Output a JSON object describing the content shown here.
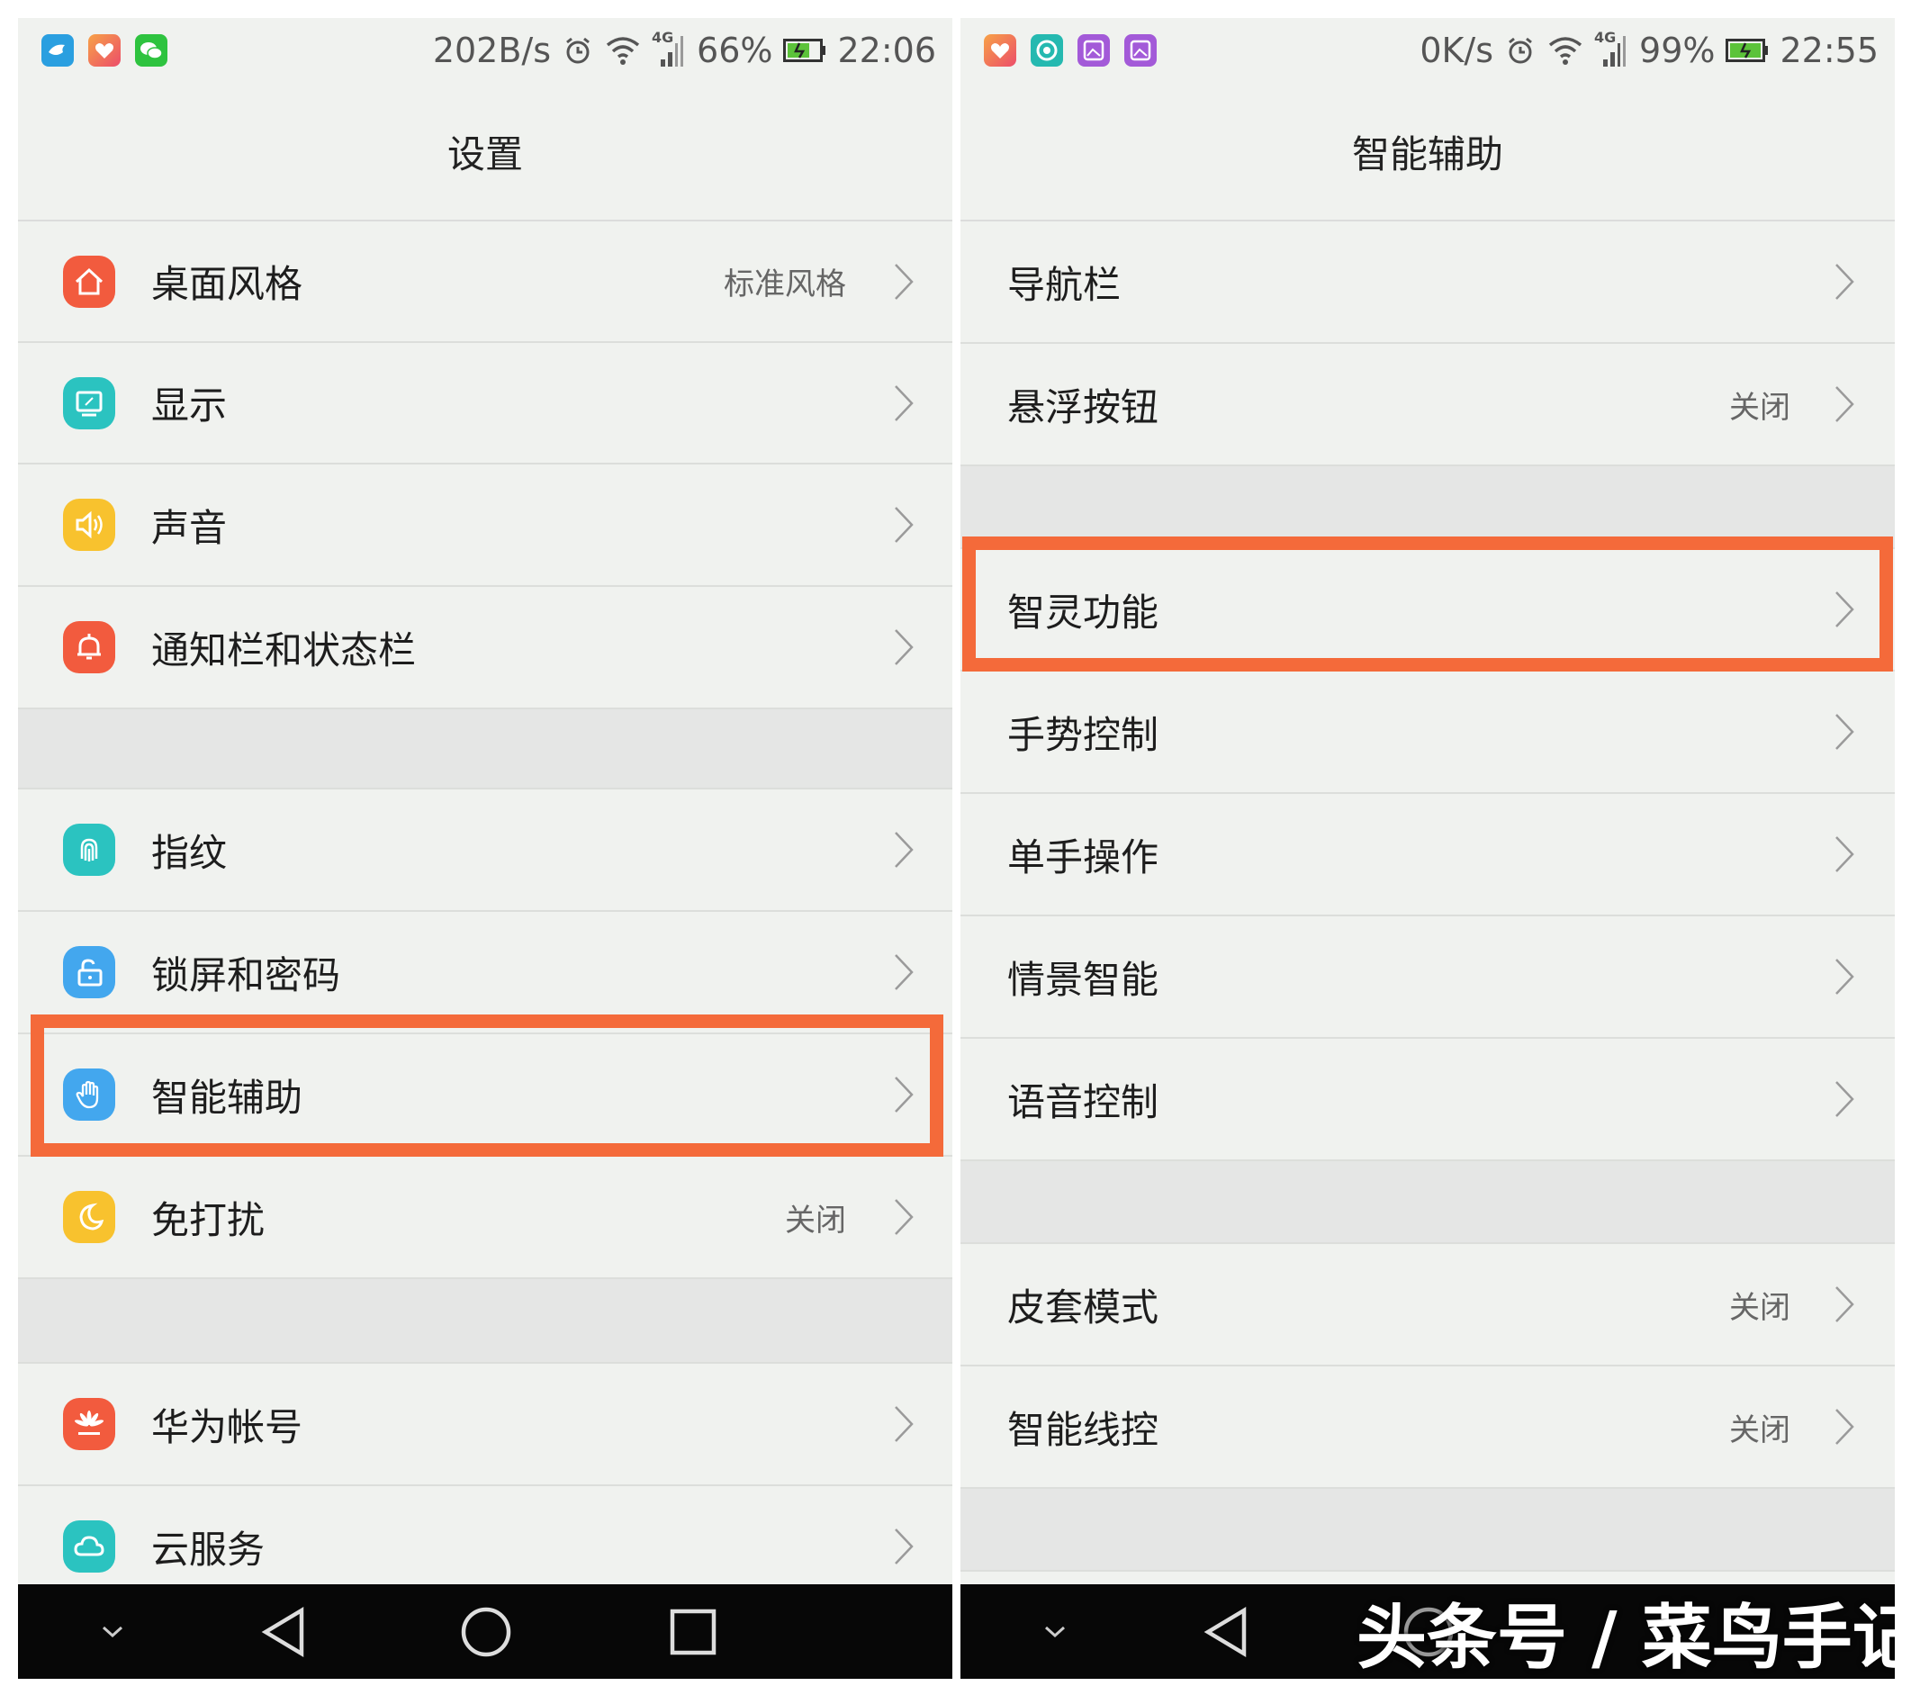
{
  "colors": {
    "highlight": "#f46a3a",
    "list_bg": "#f0f2ef",
    "section_gap": "#e5e6e5",
    "nav_bg": "#070707"
  },
  "left": {
    "status": {
      "speed": "202B/s",
      "battery": "66%",
      "time": "22:06",
      "network": "4G"
    },
    "title": "设置",
    "items": [
      {
        "label": "桌面风格",
        "value": "标准风格",
        "icon": "home-icon"
      },
      {
        "label": "显示",
        "value": "",
        "icon": "display-icon"
      },
      {
        "label": "声音",
        "value": "",
        "icon": "speaker-icon"
      },
      {
        "label": "通知栏和状态栏",
        "value": "",
        "icon": "bell-icon"
      },
      {
        "label": "指纹",
        "value": "",
        "icon": "fingerprint-icon"
      },
      {
        "label": "锁屏和密码",
        "value": "",
        "icon": "unlock-icon"
      },
      {
        "label": "智能辅助",
        "value": "",
        "icon": "hand-icon"
      },
      {
        "label": "免打扰",
        "value": "关闭",
        "icon": "moon-icon"
      },
      {
        "label": "华为帐号",
        "value": "",
        "icon": "huawei-logo-icon"
      },
      {
        "label": "云服务",
        "value": "",
        "icon": "cloud-icon"
      }
    ],
    "highlighted_item": "智能辅助"
  },
  "right": {
    "status": {
      "speed": "0K/s",
      "battery": "99%",
      "time": "22:55",
      "network": "4G"
    },
    "title": "智能辅助",
    "items": [
      {
        "label": "导航栏",
        "value": ""
      },
      {
        "label": "悬浮按钮",
        "value": "关闭"
      },
      {
        "label": "智灵功能",
        "value": ""
      },
      {
        "label": "手势控制",
        "value": ""
      },
      {
        "label": "单手操作",
        "value": ""
      },
      {
        "label": "情景智能",
        "value": ""
      },
      {
        "label": "语音控制",
        "value": ""
      },
      {
        "label": "皮套模式",
        "value": "关闭"
      },
      {
        "label": "智能线控",
        "value": "关闭"
      }
    ],
    "highlighted_item": "智灵功能",
    "watermark": "头条号 / 菜鸟手记"
  }
}
